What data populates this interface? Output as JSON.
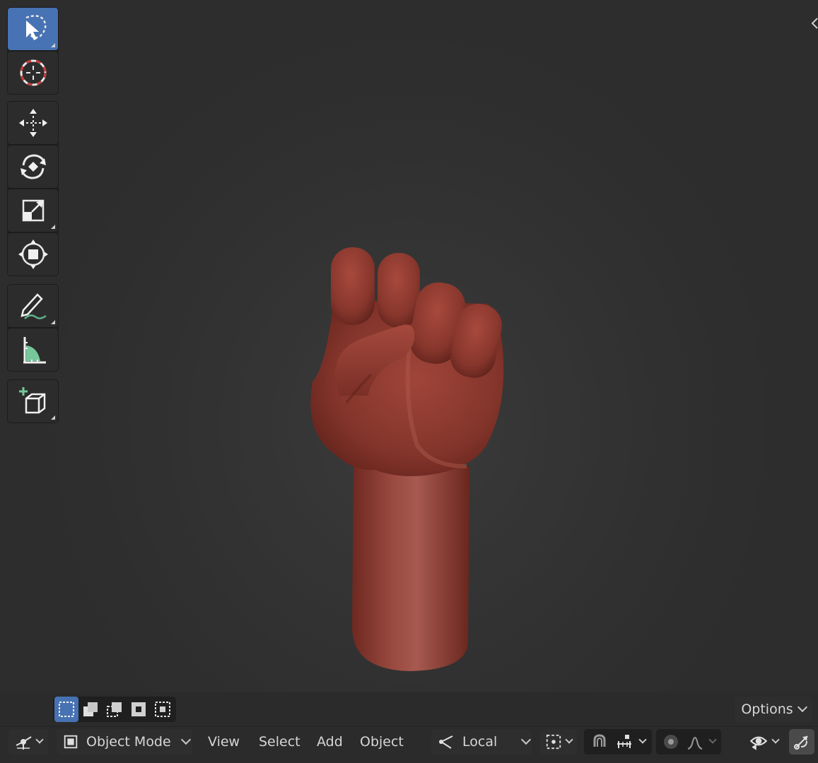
{
  "header": {
    "mode_label": "Object Mode",
    "menus": [
      "View",
      "Select",
      "Add",
      "Object"
    ],
    "transform_orientation": "Local",
    "options_label": "Options"
  },
  "toolbar": {
    "tools": [
      "select-box",
      "cursor",
      "move",
      "rotate",
      "scale",
      "transform",
      "annotate",
      "measure",
      "add-cube"
    ],
    "active_tool": "select-box"
  },
  "colors": {
    "accent": "#4772b3",
    "viewport_bg": "#303030",
    "model_skin": "#8a3529"
  }
}
